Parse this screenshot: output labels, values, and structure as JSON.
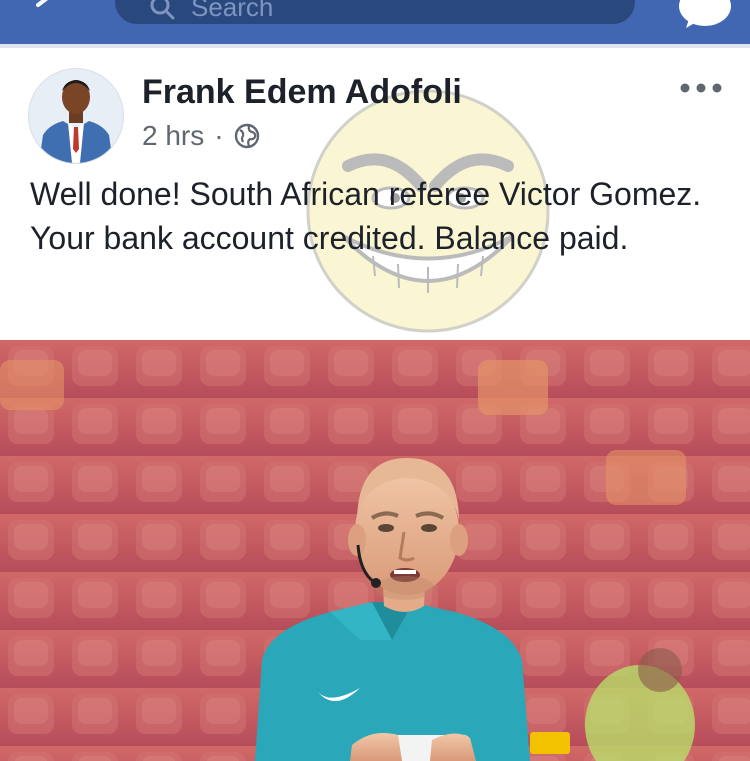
{
  "topbar": {
    "search_placeholder": "Search",
    "icons": [
      "back-icon",
      "search-icon",
      "messenger-icon"
    ]
  },
  "post": {
    "author": "Frank Edem Adofoli",
    "time": "2 hrs",
    "separator": "·",
    "privacy_icon": "globe-icon",
    "more_icon": "more-icon",
    "text": "Well done! South African referee Victor Gomez. Your bank account credited. Balance paid."
  },
  "colors": {
    "facebook_blue": "#4267b2",
    "search_bg": "#29487d",
    "text_primary": "#1d2129",
    "text_secondary": "#606770",
    "jersey": "#2aa7b8",
    "stands": "#c85a63"
  }
}
